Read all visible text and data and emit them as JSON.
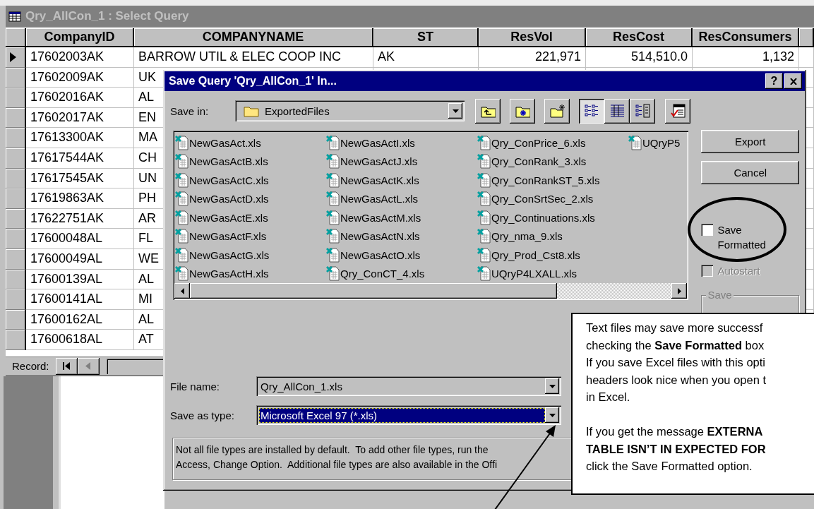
{
  "window": {
    "title": "Qry_AllCon_1 : Select Query"
  },
  "table": {
    "columns": [
      {
        "label": "CompanyID",
        "kind": "text"
      },
      {
        "label": "COMPANYNAME",
        "kind": "text"
      },
      {
        "label": "ST",
        "kind": "text"
      },
      {
        "label": "ResVol",
        "kind": "number"
      },
      {
        "label": "ResCost",
        "kind": "number"
      },
      {
        "label": "ResConsumers",
        "kind": "number"
      }
    ],
    "rows": [
      {
        "current": true,
        "cells": [
          "17602003AK",
          "BARROW UTIL & ELEC COOP INC",
          "AK",
          "221,971",
          "514,510.0",
          "1,132"
        ]
      },
      {
        "current": false,
        "cells": [
          "17602009AK",
          "UK"
        ]
      },
      {
        "current": false,
        "cells": [
          "17602016AK",
          "AL"
        ]
      },
      {
        "current": false,
        "cells": [
          "17602017AK",
          "EN"
        ]
      },
      {
        "current": false,
        "cells": [
          "17613300AK",
          "MA"
        ]
      },
      {
        "current": false,
        "cells": [
          "17617544AK",
          "CH"
        ]
      },
      {
        "current": false,
        "cells": [
          "17617545AK",
          "UN"
        ]
      },
      {
        "current": false,
        "cells": [
          "17619863AK",
          "PH"
        ]
      },
      {
        "current": false,
        "cells": [
          "17622751AK",
          "AR"
        ]
      },
      {
        "current": false,
        "cells": [
          "17600048AL",
          "FL"
        ]
      },
      {
        "current": false,
        "cells": [
          "17600049AL",
          "WE"
        ]
      },
      {
        "current": false,
        "cells": [
          "17600139AL",
          "AL"
        ]
      },
      {
        "current": false,
        "cells": [
          "17600141AL",
          "MI"
        ]
      },
      {
        "current": false,
        "cells": [
          "17600162AL",
          "AL"
        ]
      },
      {
        "current": false,
        "cells": [
          "17600618AL",
          "AT"
        ]
      }
    ]
  },
  "record_bar": {
    "label": "Record:",
    "buttons": [
      {
        "kind": "first",
        "disabled": false
      },
      {
        "kind": "previous",
        "disabled": true
      }
    ]
  },
  "dialog": {
    "title": "Save Query 'Qry_AllCon_1' In...",
    "help": "?",
    "save_in": {
      "label": "Save in:",
      "value": "ExportedFiles"
    },
    "toolbar": [
      {
        "kind": "up-folder"
      },
      {
        "kind": "web-folder"
      },
      {
        "kind": "new-folder"
      }
    ],
    "views": [
      {
        "kind": "list",
        "selected": true
      },
      {
        "kind": "details",
        "selected": false
      },
      {
        "kind": "properties",
        "selected": false
      }
    ],
    "tools": [
      {
        "kind": "tools"
      }
    ],
    "files": [
      [
        "NewGasAct.xls",
        "NewGasActB.xls",
        "NewGasActC.xls",
        "NewGasActD.xls",
        "NewGasActE.xls",
        "NewGasActF.xls",
        "NewGasActG.xls",
        "NewGasActH.xls"
      ],
      [
        "NewGasActI.xls",
        "NewGasActJ.xls",
        "NewGasActK.xls",
        "NewGasActL.xls",
        "NewGasActM.xls",
        "NewGasActN.xls",
        "NewGasActO.xls",
        "Qry_ConCT_4.xls"
      ],
      [
        "Qry_ConPrice_6.xls",
        "Qry_ConRank_3.xls",
        "Qry_ConRankST_5.xls",
        "Qry_ConSrtSec_2.xls",
        "Qry_Continuations.xls",
        "Qry_nma_9.xls",
        "Qry_Prod_Cst8.xls",
        "UQryP4LXALL.xls"
      ],
      [
        "UQryP5"
      ]
    ],
    "buttons": [
      "Export",
      "Cancel"
    ],
    "options": [
      {
        "label": "Save Formatted",
        "checked": false,
        "disabled": false
      },
      {
        "label": "Autostart",
        "checked": false,
        "disabled": true
      }
    ],
    "group_label": "Save",
    "file_name": {
      "label": "File name:",
      "value": "Qry_AllCon_1.xls",
      "selected": false
    },
    "save_as_type": {
      "label": "Save as type:",
      "value": "Microsoft Excel 97 (*.xls)",
      "selected": true
    },
    "note": [
      "Not all file types are installed by default.  To add other file types, run the",
      "Access, Change Option.  Additional file types are also available in the Offi"
    ]
  },
  "callout": {
    "paragraphs": [
      [
        "Text files may save more successf",
        "checking the **Save Formatted** box",
        "If you save Excel files with this opti",
        "headers look nice when you open t",
        "in Excel."
      ],
      [
        "If you get the message **EXTERNA**",
        "**TABLE ISN’T IN EXPECTED FOR**",
        "click the Save Formatted option."
      ]
    ]
  }
}
